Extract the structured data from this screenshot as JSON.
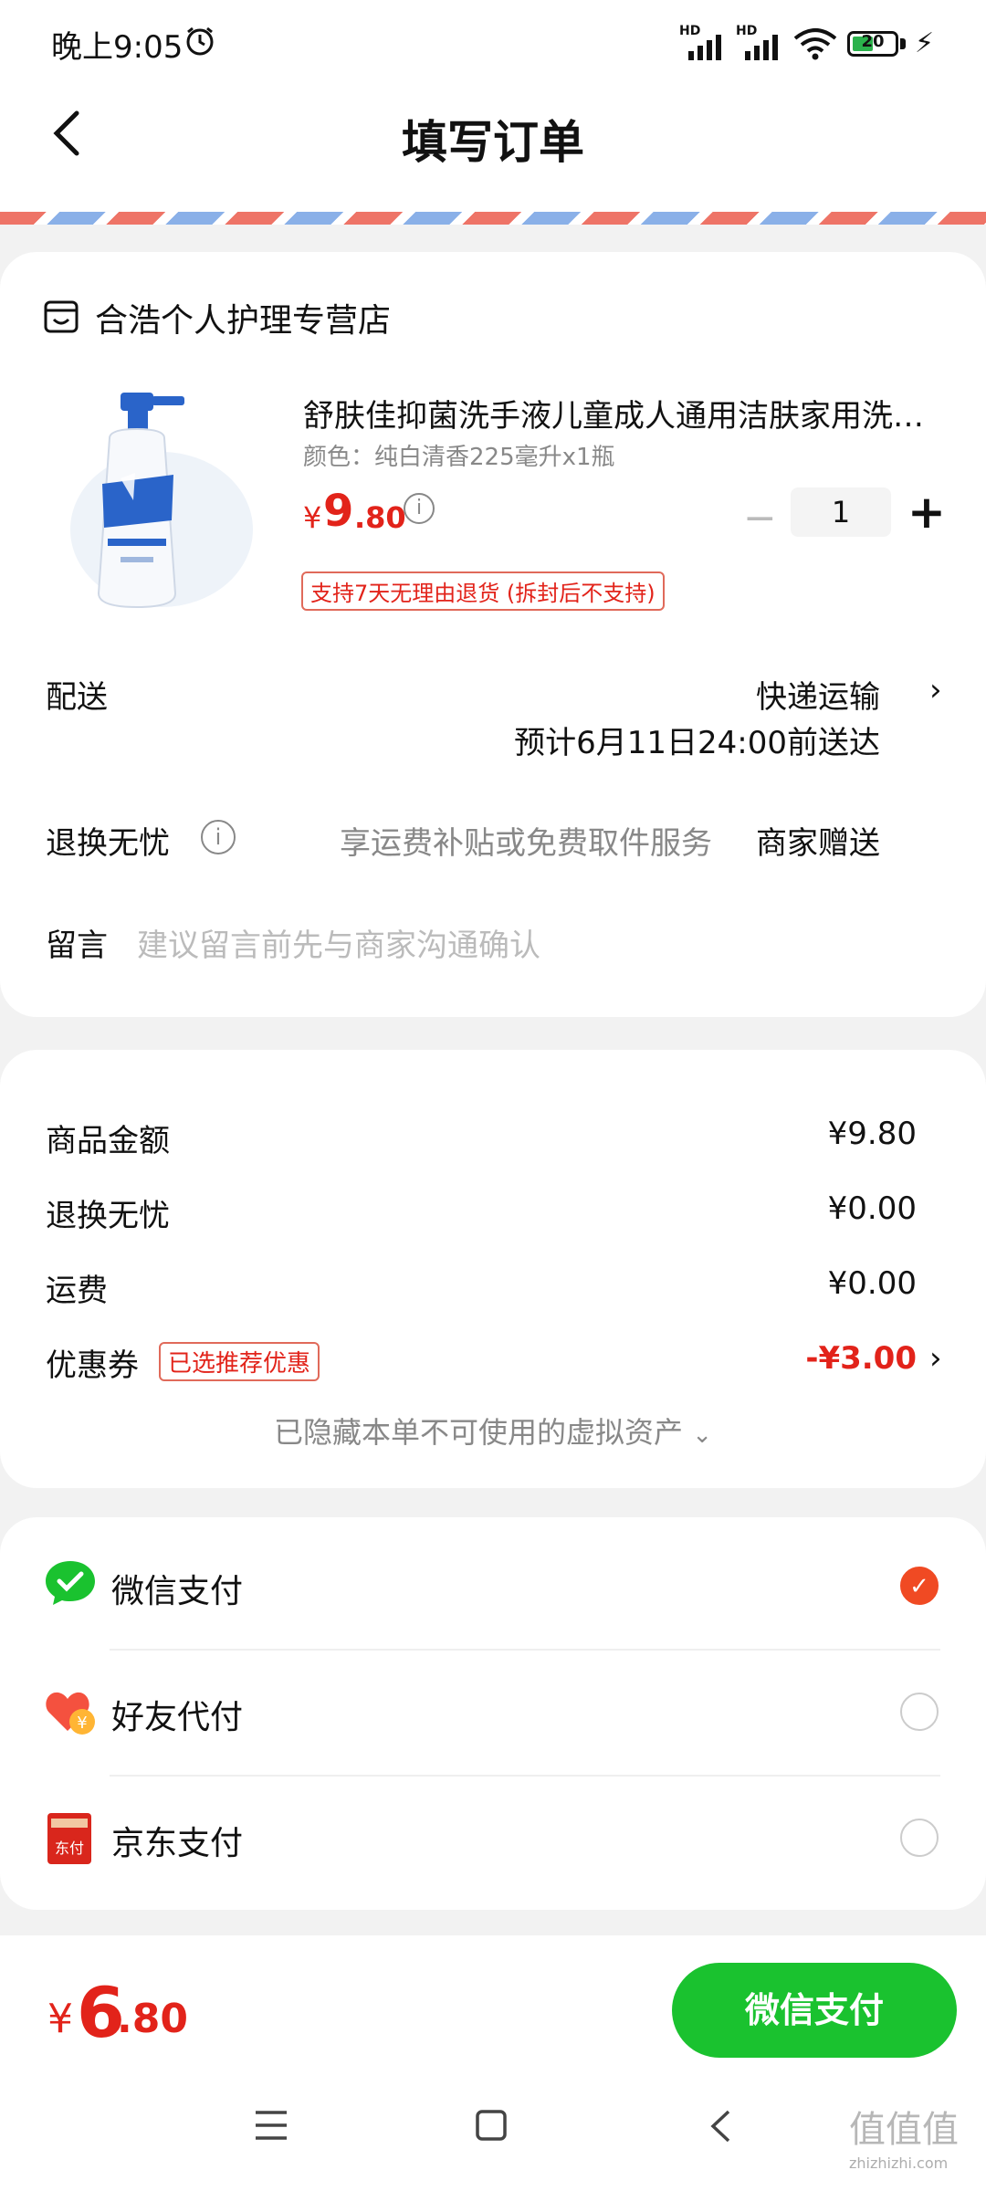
{
  "status_bar": {
    "time": "晚上9:05",
    "signal1": "HD",
    "signal2": "HD",
    "battery": "20"
  },
  "header": {
    "title": "填写订单"
  },
  "store": {
    "name": "合浩个人护理专营店"
  },
  "product": {
    "title": "舒肤佳抑菌洗手液儿童成人通用洁肤家用洗手液",
    "variant": "颜色：纯白清香225毫升x1瓶",
    "price_currency": "¥",
    "price_integer": "9",
    "price_decimal": ".80",
    "quantity": "1",
    "return_badge": "支持7天无理由退货 (拆封后不支持)"
  },
  "delivery": {
    "label": "配送",
    "method": "快递运输",
    "eta": "预计6月11日24:00前送达"
  },
  "returns": {
    "label": "退换无忧",
    "description": "享运费补贴或免费取件服务",
    "value": "商家赠送"
  },
  "message": {
    "label": "留言",
    "placeholder": "建议留言前先与商家沟通确认"
  },
  "summary": {
    "goods_label": "商品金额",
    "goods_value": "¥9.80",
    "returns_label": "退换无忧",
    "returns_value": "¥0.00",
    "shipping_label": "运费",
    "shipping_value": "¥0.00",
    "coupon_label": "优惠券",
    "coupon_badge": "已选推荐优惠",
    "coupon_value": "-¥3.00",
    "hidden_assets": "已隐藏本单不可使用的虚拟资产"
  },
  "payment": {
    "options": [
      {
        "label": "微信支付",
        "selected": true
      },
      {
        "label": "好友代付",
        "selected": false
      },
      {
        "label": "京东支付",
        "selected": false
      }
    ],
    "jd_icon_text": "东付",
    "friend_icon_text": "¥"
  },
  "footer": {
    "total_currency": "¥",
    "total_integer": "6",
    "total_decimal": ".80",
    "pay_button": "微信支付"
  },
  "watermark": {
    "main": "值值值",
    "sub": "zhizhizhi.com"
  },
  "colors": {
    "accent_red": "#e2231a",
    "wechat_green": "#1ac22f",
    "selected_orange": "#f04a23"
  }
}
